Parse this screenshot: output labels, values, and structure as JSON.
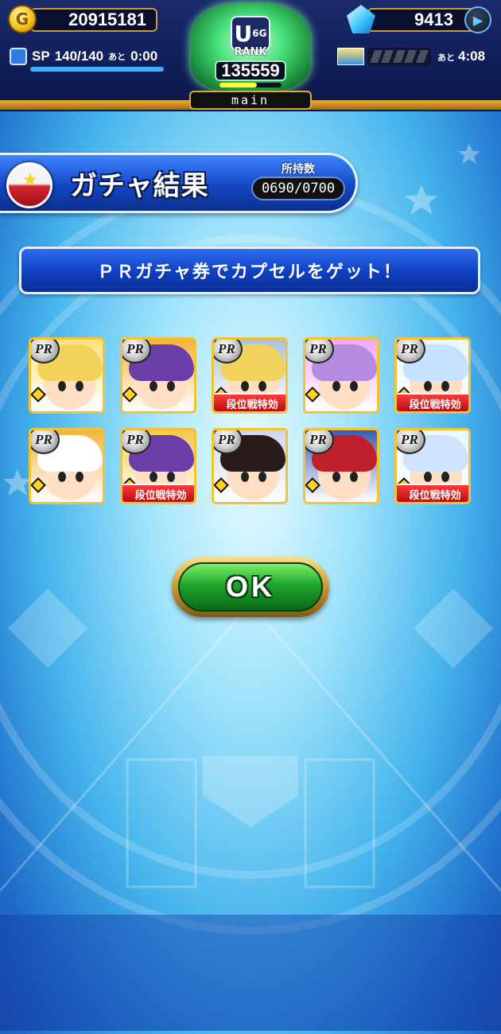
{
  "hud": {
    "coins": "20915181",
    "coin_symbol": "G",
    "gems": "9413",
    "sp_label": "SP",
    "sp_value": "140/140",
    "sp_remaining_prefix": "あと",
    "sp_remaining_time": "0:00",
    "sp_fill_fraction": 1.0,
    "rank_letter": "U",
    "rank_superscript": "6",
    "rank_sub": "G",
    "rank_label": "RANK",
    "rank_value": "135559",
    "rank_progress_fraction": 0.6,
    "tab_label": "main",
    "stamina_remaining_prefix": "あと",
    "stamina_time": "4:08"
  },
  "title": {
    "text": "ガチャ結果",
    "owned_label": "所持数",
    "owned_value": "0690/0700"
  },
  "message": "ＰＲガチャ券でカプセルをゲット！",
  "cards": [
    {
      "badge": "PR",
      "hair": "#f3d25a",
      "bg": "#ffe27a",
      "tag": ""
    },
    {
      "badge": "PR",
      "hair": "#6b3da8",
      "bg": "#f5b23a",
      "tag": ""
    },
    {
      "badge": "PR",
      "hair": "#f0d25c",
      "bg": "#a9c1d8",
      "tag": "段位戦特効"
    },
    {
      "badge": "PR",
      "hair": "#b48be0",
      "bg": "#f0a8ff",
      "tag": ""
    },
    {
      "badge": "PR",
      "hair": "#c5e3ff",
      "bg": "#eaf6ff",
      "tag": "段位戦特効"
    },
    {
      "badge": "PR",
      "hair": "#ffffff",
      "bg": "#f4b23d",
      "tag": ""
    },
    {
      "badge": "PR",
      "hair": "#6b3da8",
      "bg": "#f5c84a",
      "tag": "段位戦特効"
    },
    {
      "badge": "PR",
      "hair": "#2a1b1b",
      "bg": "#cfd6e6",
      "tag": ""
    },
    {
      "badge": "PR",
      "hair": "#c0202b",
      "bg": "#3b5cb0",
      "tag": ""
    },
    {
      "badge": "PR",
      "hair": "#cfe3ff",
      "bg": "#eaf6ff",
      "tag": "段位戦特効"
    }
  ],
  "ok_button": "OK",
  "colors": {
    "accent_gold": "#f2c237",
    "banner_blue": "#1347c4",
    "ok_green": "#1fa62b",
    "tag_red": "#b10d0d"
  }
}
